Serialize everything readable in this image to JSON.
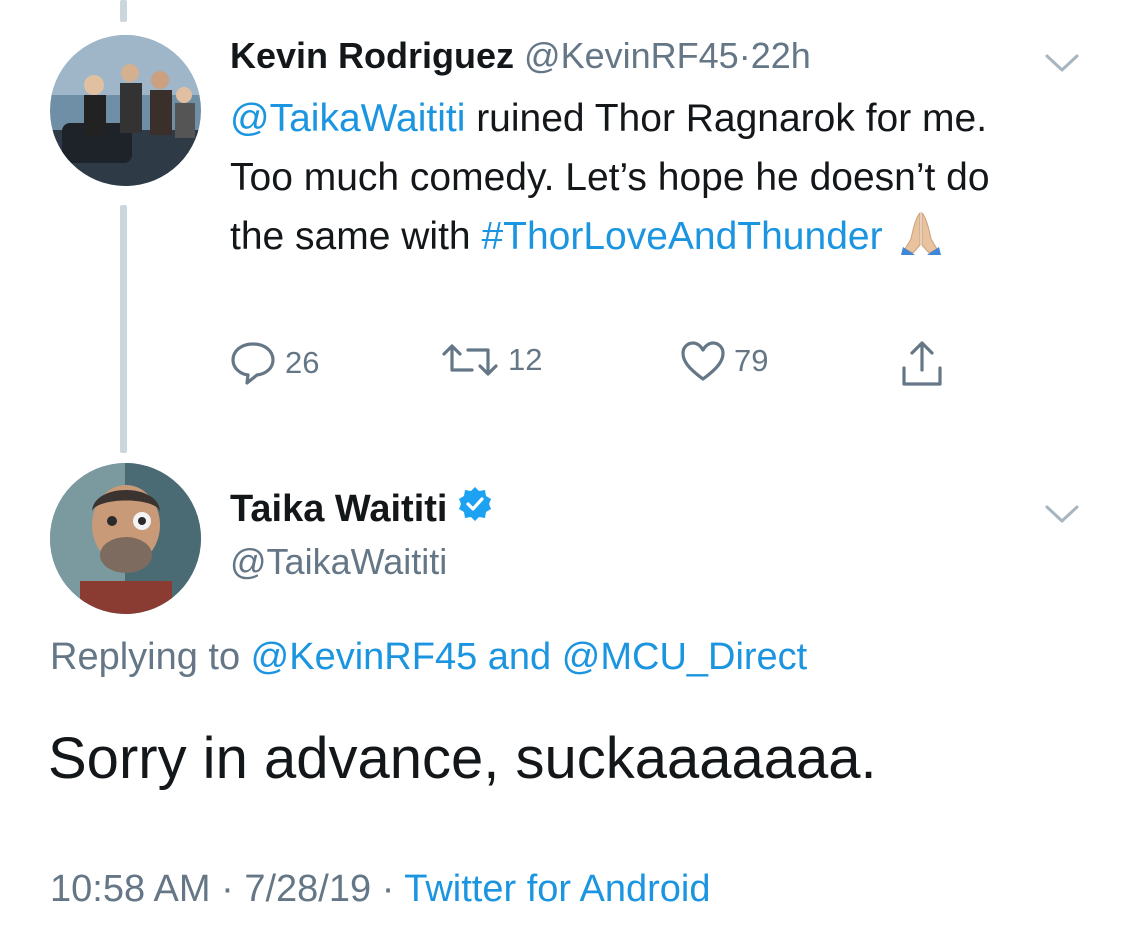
{
  "tweet1": {
    "author_name": "Kevin Rodriguez",
    "handle": "@KevinRF45",
    "separator": "·",
    "time": "22h",
    "mention": "@TaikaWaititi",
    "text_part1": " ruined Thor Ragnarok for me. Too much comedy. Let’s hope he doesn’t do the same with ",
    "hashtag": "#ThorLoveAndThunder",
    "emoji": "folded-hands-emoji",
    "replies": "26",
    "retweets": "12",
    "likes": "79"
  },
  "tweet2": {
    "author_name": "Taika Waititi",
    "verified_icon": "verified-badge-icon",
    "handle": "@TaikaWaititi",
    "replying_prefix": "Replying to ",
    "reply_to_1": "@KevinRF45",
    "reply_and": " and ",
    "reply_to_2": "@MCU_Direct",
    "text": "Sorry in advance, suckaaaaaaa.",
    "time": "10:58 AM",
    "date_sep": " · ",
    "date": "7/28/19",
    "source_sep": " · ",
    "source": "Twitter for Android"
  },
  "icons": {
    "reply": "reply-icon",
    "retweet": "retweet-icon",
    "like": "heart-icon",
    "share": "share-icon",
    "menu": "chevron-down-icon"
  },
  "colors": {
    "link": "#1b95e0",
    "muted": "#657786",
    "text": "#14171a",
    "thread_line": "#ccd6dd",
    "verified": "#1da1f2"
  }
}
